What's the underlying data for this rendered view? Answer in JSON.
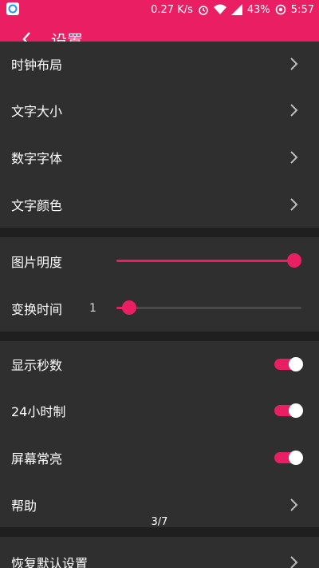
{
  "status_bar": {
    "network_speed": "0.27 K/s",
    "battery": "43%",
    "time": "5:57",
    "icons": [
      "app-icon",
      "alarm-icon",
      "wifi-icon",
      "signal-icon",
      "battery-icon",
      "sync-icon"
    ]
  },
  "toolbar": {
    "back_icon": "chevron-left-icon",
    "title": "设置"
  },
  "group1": {
    "items": [
      {
        "label": "时钟布局"
      },
      {
        "label": "文字大小"
      },
      {
        "label": "数字字体"
      },
      {
        "label": "文字颜色"
      }
    ]
  },
  "group2": {
    "brightness_label": "图片明度",
    "brightness_level": 1.0,
    "interval_label": "变换时间",
    "interval_value": "1",
    "interval_level": 0.07
  },
  "group3": {
    "show_seconds_label": "显示秒数",
    "show_seconds_on": true,
    "format_24h_label": "24小时制",
    "format_24h_on": true,
    "keep_screen_on_label": "屏幕常亮",
    "keep_screen_on_on": true,
    "help_label": "帮助"
  },
  "page_indicator": "3/7",
  "group4": {
    "reset_label": "恢复默认设置"
  },
  "colors": {
    "accent": "#e91e63",
    "background": "#2f2f2f",
    "separator": "#1f1f1f"
  }
}
